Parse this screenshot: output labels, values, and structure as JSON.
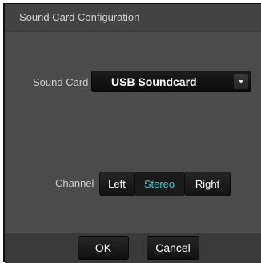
{
  "dialog": {
    "title": "Sound Card Configuration"
  },
  "sound_card": {
    "label": "Sound Card",
    "selected": "USB Soundcard"
  },
  "channel": {
    "label": "Channel",
    "options": [
      "Left",
      "Stereo",
      "Right"
    ],
    "selected": "Stereo"
  },
  "buttons": {
    "ok": "OK",
    "cancel": "Cancel"
  },
  "colors": {
    "selected_option": "#2ed2d8",
    "background": "#4b4b4b"
  }
}
